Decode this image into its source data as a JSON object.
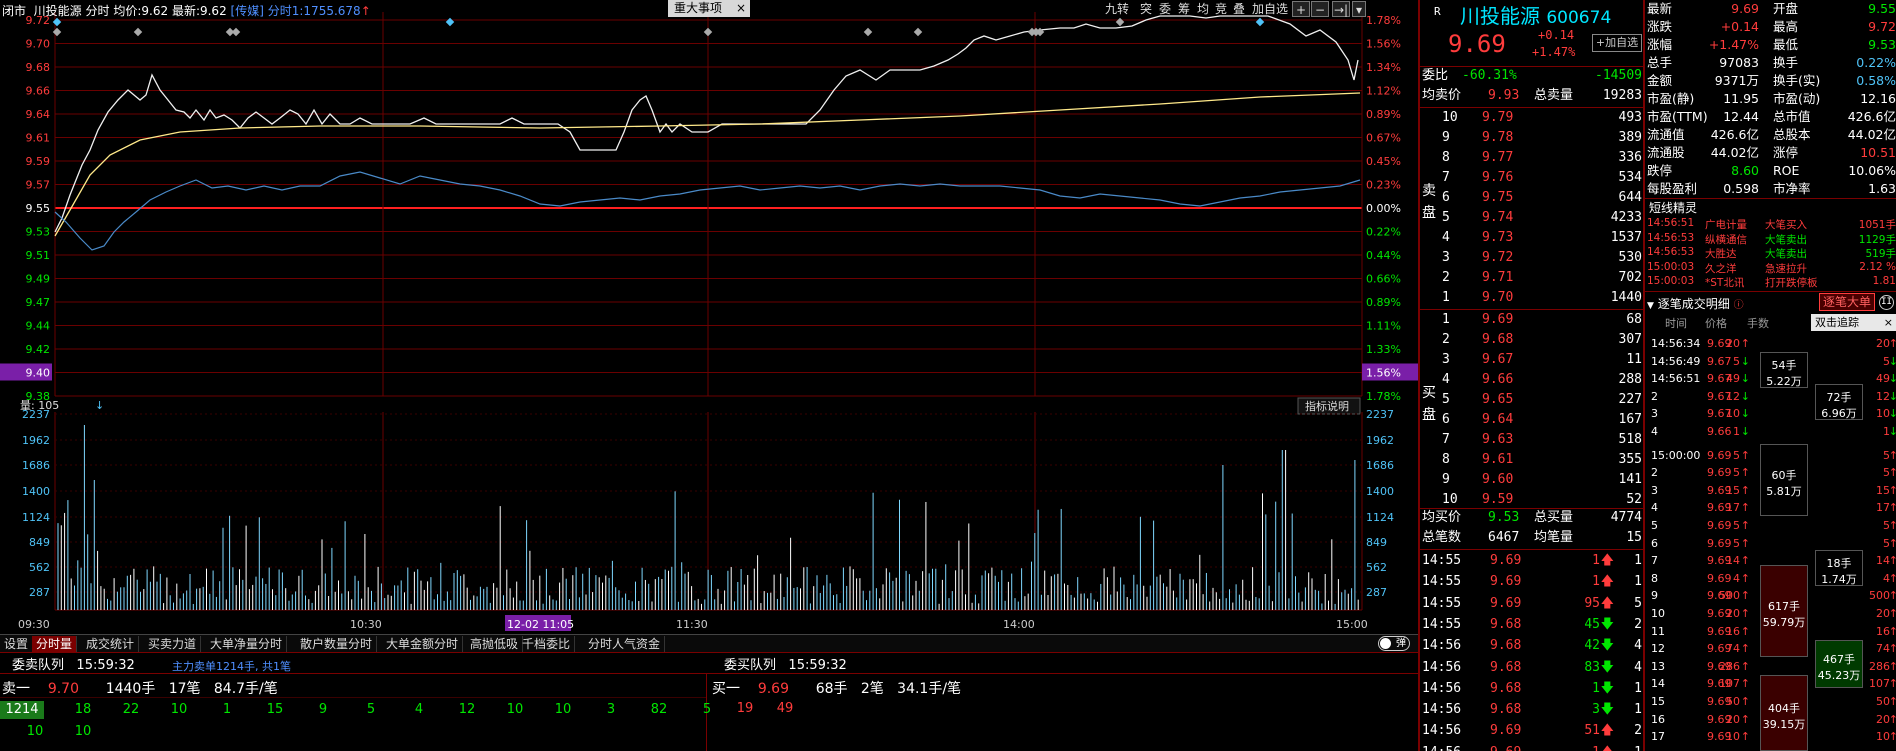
{
  "header": {
    "status": "闭市",
    "stock_name": "川投能源",
    "mode": "分时",
    "avg_label": "均价:",
    "avg_value": "9.62",
    "last_label": "最新:",
    "last_value": "9.62",
    "tag": "[传媒]",
    "tick_label": "分时1:",
    "tick_value": "1755.678",
    "event_tab": "重大事项",
    "close": "×"
  },
  "toolbar": [
    "九转",
    "突",
    "委",
    "筹",
    "均",
    "竞",
    "叠",
    "加自选",
    "+",
    "−",
    "→|",
    "▾"
  ],
  "price_axis_left": [
    "9.72",
    "9.70",
    "9.68",
    "9.66",
    "9.64",
    "9.61",
    "9.59",
    "9.57",
    "9.55",
    "9.53",
    "9.51",
    "9.49",
    "9.47",
    "9.44",
    "9.42",
    "9.40",
    "9.38"
  ],
  "pct_axis_right": [
    "1.78%",
    "1.56%",
    "1.34%",
    "1.12%",
    "0.89%",
    "0.67%",
    "0.45%",
    "0.23%",
    "0.00%",
    "0.22%",
    "0.44%",
    "0.66%",
    "0.89%",
    "1.11%",
    "1.33%",
    "1.56%",
    "1.78%"
  ],
  "volume": {
    "label": "量: 105",
    "indicator": "指标说明",
    "axis": [
      "2237",
      "1962",
      "1686",
      "1400",
      "1124",
      "849",
      "562",
      "287"
    ]
  },
  "time_axis": [
    "09:30",
    "10:30",
    "12-02 11:05",
    "11:30",
    "14:00",
    "15:00"
  ],
  "bottom_tabs": [
    "设置",
    "分时量",
    "成交统计",
    "买卖力道",
    "大单净量分时",
    "散户数量分时",
    "大单金额分时",
    "高抛低吸",
    "千档委比",
    "分时人气资金"
  ],
  "toggle": "弹",
  "queues": {
    "sell_title": "委卖队列",
    "sell_time": "15:59:32",
    "sell_sub": "主力卖单1214手, 共1笔",
    "buy_title": "委买队列",
    "buy_time": "15:59:32",
    "sell_head": [
      "卖一",
      "9.70",
      "1440手",
      "17笔",
      "84.7手/笔"
    ],
    "buy_head": [
      "买一",
      "9.69",
      "68手",
      "2笔",
      "34.1手/笔"
    ],
    "sell_orders1": [
      "1214",
      "18",
      "22",
      "10",
      "1",
      "15",
      "9",
      "5",
      "4",
      "12",
      "10",
      "10",
      "3",
      "82",
      "5"
    ],
    "sell_orders2": [
      "10",
      "10"
    ],
    "buy_orders": [
      "19",
      "49"
    ]
  },
  "quote": {
    "r": "R",
    "name": "川投能源",
    "code": "600674",
    "price": "9.69",
    "chg": "+0.14",
    "pct": "+1.47%",
    "add_btn": "+加自选",
    "weibi_label": "委比",
    "weibi_pct": "-60.31%",
    "weibi_val": "-14509",
    "avg_sell_label": "均卖价",
    "avg_sell": "9.93",
    "total_sell_label": "总卖量",
    "total_sell": "19283",
    "asks": [
      [
        "10",
        "9.79",
        "493"
      ],
      [
        "9",
        "9.78",
        "389"
      ],
      [
        "8",
        "9.77",
        "336"
      ],
      [
        "7",
        "9.76",
        "534"
      ],
      [
        "6",
        "9.75",
        "644"
      ],
      [
        "5",
        "9.74",
        "4233"
      ],
      [
        "4",
        "9.73",
        "1537"
      ],
      [
        "3",
        "9.72",
        "530"
      ],
      [
        "2",
        "9.71",
        "702"
      ],
      [
        "1",
        "9.70",
        "1440"
      ]
    ],
    "bids": [
      [
        "1",
        "9.69",
        "68"
      ],
      [
        "2",
        "9.68",
        "307"
      ],
      [
        "3",
        "9.67",
        "11"
      ],
      [
        "4",
        "9.66",
        "288"
      ],
      [
        "5",
        "9.65",
        "227"
      ],
      [
        "6",
        "9.64",
        "167"
      ],
      [
        "7",
        "9.63",
        "518"
      ],
      [
        "8",
        "9.61",
        "355"
      ],
      [
        "9",
        "9.60",
        "141"
      ],
      [
        "10",
        "9.59",
        "52"
      ]
    ],
    "sell_side": "卖盘",
    "buy_side": "买盘",
    "avg_buy_label": "均买价",
    "avg_buy": "9.53",
    "total_buy_label": "总买量",
    "total_buy": "4774",
    "total_trades_label": "总笔数",
    "total_trades": "6467",
    "avg_vol_label": "均笔量",
    "avg_vol": "15",
    "ticks": [
      [
        "14:55",
        "9.69",
        "1",
        "up",
        "1"
      ],
      [
        "14:55",
        "9.69",
        "1",
        "up",
        "1"
      ],
      [
        "14:55",
        "9.69",
        "95",
        "up",
        "5"
      ],
      [
        "14:55",
        "9.68",
        "45",
        "dn",
        "2"
      ],
      [
        "14:56",
        "9.68",
        "42",
        "dn",
        "4"
      ],
      [
        "14:56",
        "9.68",
        "83",
        "dn",
        "4"
      ],
      [
        "14:56",
        "9.68",
        "1",
        "dn",
        "1"
      ],
      [
        "14:56",
        "9.68",
        "3",
        "dn",
        "1"
      ],
      [
        "14:56",
        "9.69",
        "51",
        "up",
        "2"
      ],
      [
        "14:56",
        "9.69",
        "1",
        "up",
        "1"
      ]
    ]
  },
  "stats": [
    [
      "最新",
      "9.69",
      "开盘",
      "9.55"
    ],
    [
      "涨跌",
      "+0.14",
      "最高",
      "9.72"
    ],
    [
      "涨幅",
      "+1.47%",
      "最低",
      "9.53"
    ],
    [
      "总手",
      "97083",
      "换手",
      "0.22%"
    ],
    [
      "金额",
      "9371万",
      "换手(实)",
      "0.58%"
    ],
    [
      "市盈(静)",
      "11.95",
      "市盈(动)",
      "12.16"
    ],
    [
      "市盈(TTM)",
      "12.44",
      "总市值",
      "426.6亿"
    ],
    [
      "流通值",
      "426.6亿",
      "总股本",
      "44.02亿"
    ],
    [
      "流通股",
      "44.02亿",
      "涨停",
      "10.51"
    ],
    [
      "跌停",
      "8.60",
      "ROE",
      "10.06%"
    ],
    [
      "每股盈利",
      "0.598",
      "市净率",
      "1.63"
    ]
  ],
  "short_title": "短线精灵",
  "short": [
    [
      "14:56:51",
      "广电计量",
      "大笔买入",
      "1051手"
    ],
    [
      "14:56:53",
      "纵横通信",
      "大笔卖出",
      "1129手"
    ],
    [
      "14:56:53",
      "大胜达",
      "大笔卖出",
      "519手"
    ],
    [
      "15:00:03",
      "久之洋",
      "急速拉升",
      "2.12 %"
    ],
    [
      "15:00:03",
      "*ST北讯",
      "打开跌停板",
      "1.81"
    ]
  ],
  "deals_title": "逐笔成交明细",
  "deals_btn": "逐笔大单",
  "deals_cols": [
    "时间",
    "价格",
    "手数"
  ],
  "deals_popup": "双击追踪",
  "deals": [
    [
      "14:56:34",
      "9.69",
      "20",
      "20"
    ],
    [
      "14:56:49",
      "9.67",
      "5",
      "5"
    ],
    [
      "14:56:51",
      "9.67",
      "49",
      "49"
    ],
    [
      "2",
      "9.67",
      "12",
      "12"
    ],
    [
      "3",
      "9.67",
      "10",
      "10"
    ],
    [
      "4",
      "9.66",
      "1",
      "1"
    ],
    [
      "15:00:00",
      "9.69",
      "5",
      "5"
    ],
    [
      "2",
      "9.69",
      "5",
      "5"
    ],
    [
      "3",
      "9.69",
      "15",
      "15"
    ],
    [
      "4",
      "9.69",
      "17",
      "17"
    ],
    [
      "5",
      "9.69",
      "5",
      "5"
    ],
    [
      "6",
      "9.69",
      "5",
      "5"
    ],
    [
      "7",
      "9.69",
      "14",
      "14"
    ],
    [
      "8",
      "9.69",
      "4",
      "4"
    ],
    [
      "9",
      "9.69",
      "500",
      "500"
    ],
    [
      "10",
      "9.69",
      "20",
      "20"
    ],
    [
      "11",
      "9.69",
      "16",
      "16"
    ],
    [
      "12",
      "9.69",
      "74",
      "74"
    ],
    [
      "13",
      "9.69",
      "286",
      "286"
    ],
    [
      "14",
      "9.69",
      "107",
      "107"
    ],
    [
      "15",
      "9.69",
      "50",
      "50"
    ],
    [
      "16",
      "9.69",
      "20",
      "20"
    ],
    [
      "17",
      "9.69",
      "10",
      "10"
    ]
  ],
  "bigboxes": [
    [
      "54手",
      "5.22万"
    ],
    [
      "72手",
      "6.96万"
    ],
    [
      "60手",
      "5.81万"
    ],
    [
      "18手",
      "1.74万"
    ],
    [
      "617手",
      "59.79万"
    ],
    [
      "467手",
      "45.23万"
    ],
    [
      "404手",
      "39.15万"
    ]
  ]
}
